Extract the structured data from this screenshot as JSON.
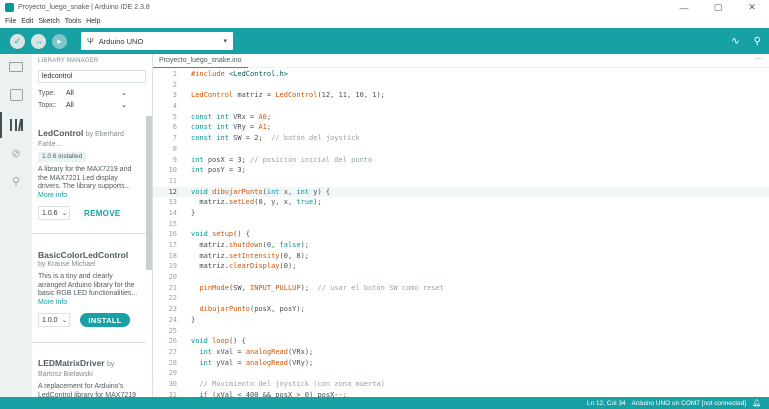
{
  "window": {
    "title": "Proyecto_luego_snake | Arduino IDE 2.3.8",
    "controls": [
      "—",
      "▢",
      "✕"
    ]
  },
  "menu": [
    "File",
    "Edit",
    "Sketch",
    "Tools",
    "Help"
  ],
  "toolbar": {
    "verify_icon": "check-icon",
    "upload_icon": "arrow-right-icon",
    "debug_icon": "debug-icon",
    "usb_icon": "usb-icon",
    "board": "Arduino UNO",
    "serial_plotter_icon": "plotter-icon",
    "serial_monitor_icon": "serial-monitor-icon"
  },
  "library_manager": {
    "header": "LIBRARY MANAGER",
    "search_value": "ledcontrol",
    "type_label": "Type:",
    "type_value": "All",
    "topic_label": "Topic:",
    "topic_value": "All",
    "items": [
      {
        "name": "LedControl",
        "by": "by Eberhard",
        "author": "Fahle...",
        "badge": "1.0.6 installed",
        "desc": "A library for the MAX7219 and the MAX7221 Led display drivers. The library supports...",
        "more": "More info",
        "version": "1.0.6",
        "action": "REMOVE"
      },
      {
        "name": "BasicColorLedControl",
        "by": "",
        "author": "by Krause Michael",
        "desc": "This is a tiny and clearly arranged Arduino library for the basic RGB LED functionalities...",
        "more": "More info",
        "version": "1.0.0",
        "action": "INSTALL"
      },
      {
        "name": "LEDMatrixDriver",
        "by": "by",
        "author": "Bartosz Bielawski",
        "desc": "A replacement for Arduino's LedControl library for MAX7219"
      }
    ]
  },
  "editor": {
    "tab": "Proyecto_luego_snake.ino",
    "tab_more": "···",
    "lines": [
      {
        "n": "1",
        "t": "#include <LedControl.h>"
      },
      {
        "n": "2",
        "t": ""
      },
      {
        "n": "3",
        "t": "LedControl matriz = LedControl(12, 11, 10, 1);"
      },
      {
        "n": "4",
        "t": ""
      },
      {
        "n": "5",
        "t": "const int VRx = A0;"
      },
      {
        "n": "6",
        "t": "const int VRy = A1;"
      },
      {
        "n": "7",
        "t": "const int SW = 2;  // botón del joystick"
      },
      {
        "n": "8",
        "t": ""
      },
      {
        "n": "9",
        "t": "int posX = 3; // posición inicial del punto"
      },
      {
        "n": "10",
        "t": "int posY = 3;"
      },
      {
        "n": "11",
        "t": ""
      },
      {
        "n": "12",
        "t": "void dibujarPunto(int x, int y) {"
      },
      {
        "n": "13",
        "t": "  matriz.setLed(0, y, x, true);"
      },
      {
        "n": "14",
        "t": "}"
      },
      {
        "n": "15",
        "t": ""
      },
      {
        "n": "16",
        "t": "void setup() {"
      },
      {
        "n": "17",
        "t": "  matriz.shutdown(0, false);"
      },
      {
        "n": "18",
        "t": "  matriz.setIntensity(0, 8);"
      },
      {
        "n": "19",
        "t": "  matriz.clearDisplay(0);"
      },
      {
        "n": "20",
        "t": ""
      },
      {
        "n": "21",
        "t": "  pinMode(SW, INPUT_PULLUP);  // usar el botón SW como reset"
      },
      {
        "n": "22",
        "t": ""
      },
      {
        "n": "23",
        "t": "  dibujarPunto(posX, posY);"
      },
      {
        "n": "24",
        "t": "}"
      },
      {
        "n": "25",
        "t": ""
      },
      {
        "n": "26",
        "t": "void loop() {"
      },
      {
        "n": "27",
        "t": "  int xVal = analogRead(VRx);"
      },
      {
        "n": "28",
        "t": "  int yVal = analogRead(VRy);"
      },
      {
        "n": "29",
        "t": ""
      },
      {
        "n": "30",
        "t": "  // Movimiento del joystick (con zona muerta)"
      },
      {
        "n": "31",
        "t": "  if (xVal < 400 && posX > 0) posX--;"
      }
    ]
  },
  "status": {
    "position": "Ln 12, Col 34",
    "board_port": "Arduino UNO on COM7 [not connected]",
    "bell_icon": "bell-icon"
  }
}
